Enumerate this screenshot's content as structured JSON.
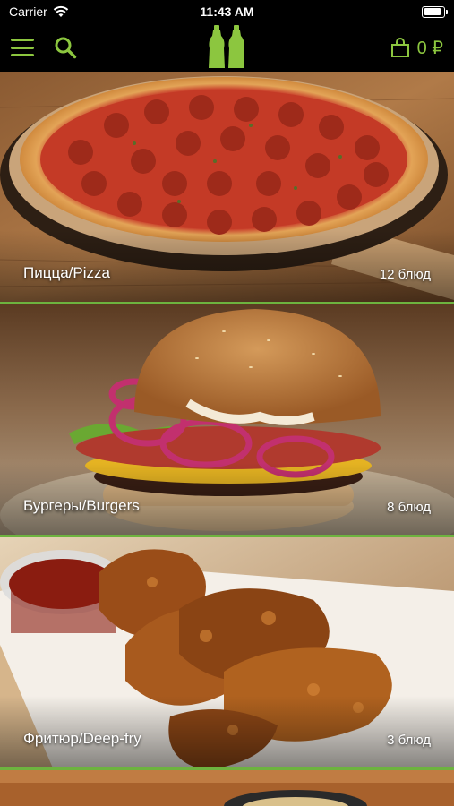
{
  "status_bar": {
    "carrier": "Carrier",
    "time": "11:43 AM",
    "battery_level": 0.9
  },
  "nav_bar": {
    "menu_icon": "hamburger-menu-icon",
    "search_icon": "search-icon",
    "logo_icon": "salt-pepper-shakers-logo",
    "cart_icon": "shopping-bag-icon",
    "cart_total": "0 ₽",
    "accent_color": "#8cc63f"
  },
  "categories": [
    {
      "name": "Пицца/Pizza",
      "count": "12 блюд",
      "image": "pepperoni-pizza-photo"
    },
    {
      "name": "Бургеры/Burgers",
      "count": "8 блюд",
      "image": "burger-photo"
    },
    {
      "name": "Фритюр/Deep-fry",
      "count": "3 блюд",
      "image": "fried-chicken-wings-photo"
    },
    {
      "name": "",
      "count": "",
      "image": "partially-visible-dish-photo"
    }
  ],
  "divider_color": "#6db33f"
}
